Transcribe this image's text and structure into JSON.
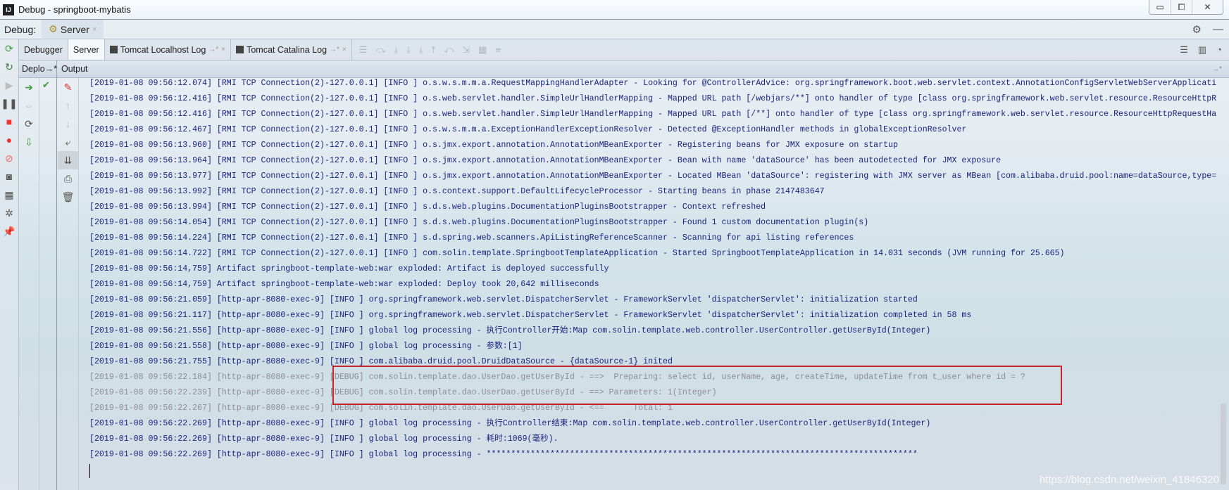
{
  "window": {
    "title": "Debug - springboot-mybatis",
    "app_icon": "IJ",
    "min": "▭",
    "max": "⧠",
    "close": "✕"
  },
  "debugbar": {
    "label": "Debug:",
    "tab": "Server",
    "close": "×",
    "settings": "⚙",
    "hide": "—"
  },
  "tabs": [
    {
      "label": "Debugger"
    },
    {
      "label": "Server"
    },
    {
      "label": "Tomcat Localhost Log",
      "pin": "→*",
      "close": "×"
    },
    {
      "label": "Tomcat Catalina Log",
      "pin": "→*",
      "close": "×"
    }
  ],
  "subheader": {
    "deploy": "Deplo→*",
    "output": "Output",
    "pin": "→*"
  },
  "log": [
    {
      "level": "info",
      "text": "[2019-01-08 09:56:12.074] [RMI TCP Connection(2)-127.0.0.1] [INFO ] o.s.w.s.m.m.a.RequestMappingHandlerAdapter - Looking for @ControllerAdvice: org.springframework.boot.web.servlet.context.AnnotationConfigServletWebServerApplicati"
    },
    {
      "level": "info",
      "text": "[2019-01-08 09:56:12.416] [RMI TCP Connection(2)-127.0.0.1] [INFO ] o.s.web.servlet.handler.SimpleUrlHandlerMapping - Mapped URL path [/webjars/**] onto handler of type [class org.springframework.web.servlet.resource.ResourceHttpR"
    },
    {
      "level": "info",
      "text": "[2019-01-08 09:56:12.416] [RMI TCP Connection(2)-127.0.0.1] [INFO ] o.s.web.servlet.handler.SimpleUrlHandlerMapping - Mapped URL path [/**] onto handler of type [class org.springframework.web.servlet.resource.ResourceHttpRequestHa"
    },
    {
      "level": "info",
      "text": "[2019-01-08 09:56:12.467] [RMI TCP Connection(2)-127.0.0.1] [INFO ] o.s.w.s.m.m.a.ExceptionHandlerExceptionResolver - Detected @ExceptionHandler methods in globalExceptionResolver"
    },
    {
      "level": "info",
      "text": "[2019-01-08 09:56:13.960] [RMI TCP Connection(2)-127.0.0.1] [INFO ] o.s.jmx.export.annotation.AnnotationMBeanExporter - Registering beans for JMX exposure on startup"
    },
    {
      "level": "info",
      "text": "[2019-01-08 09:56:13.964] [RMI TCP Connection(2)-127.0.0.1] [INFO ] o.s.jmx.export.annotation.AnnotationMBeanExporter - Bean with name 'dataSource' has been autodetected for JMX exposure"
    },
    {
      "level": "info",
      "text": "[2019-01-08 09:56:13.977] [RMI TCP Connection(2)-127.0.0.1] [INFO ] o.s.jmx.export.annotation.AnnotationMBeanExporter - Located MBean 'dataSource': registering with JMX server as MBean [com.alibaba.druid.pool:name=dataSource,type="
    },
    {
      "level": "info",
      "text": "[2019-01-08 09:56:13.992] [RMI TCP Connection(2)-127.0.0.1] [INFO ] o.s.context.support.DefaultLifecycleProcessor - Starting beans in phase 2147483647"
    },
    {
      "level": "info",
      "text": "[2019-01-08 09:56:13.994] [RMI TCP Connection(2)-127.0.0.1] [INFO ] s.d.s.web.plugins.DocumentationPluginsBootstrapper - Context refreshed"
    },
    {
      "level": "info",
      "text": "[2019-01-08 09:56:14.054] [RMI TCP Connection(2)-127.0.0.1] [INFO ] s.d.s.web.plugins.DocumentationPluginsBootstrapper - Found 1 custom documentation plugin(s)"
    },
    {
      "level": "info",
      "text": "[2019-01-08 09:56:14.224] [RMI TCP Connection(2)-127.0.0.1] [INFO ] s.d.spring.web.scanners.ApiListingReferenceScanner - Scanning for api listing references"
    },
    {
      "level": "info",
      "text": "[2019-01-08 09:56:14.722] [RMI TCP Connection(2)-127.0.0.1] [INFO ] com.solin.template.SpringbootTemplateApplication - Started SpringbootTemplateApplication in 14.031 seconds (JVM running for 25.665)"
    },
    {
      "level": "info",
      "text": "[2019-01-08 09:56:14,759] Artifact springboot-template-web:war exploded: Artifact is deployed successfully"
    },
    {
      "level": "info",
      "text": "[2019-01-08 09:56:14,759] Artifact springboot-template-web:war exploded: Deploy took 20,642 milliseconds"
    },
    {
      "level": "info",
      "text": "[2019-01-08 09:56:21.059] [http-apr-8080-exec-9] [INFO ] org.springframework.web.servlet.DispatcherServlet - FrameworkServlet 'dispatcherServlet': initialization started"
    },
    {
      "level": "info",
      "text": "[2019-01-08 09:56:21.117] [http-apr-8080-exec-9] [INFO ] org.springframework.web.servlet.DispatcherServlet - FrameworkServlet 'dispatcherServlet': initialization completed in 58 ms"
    },
    {
      "level": "info",
      "text": "[2019-01-08 09:56:21.556] [http-apr-8080-exec-9] [INFO ] global log processing - 执行Controller开始:Map com.solin.template.web.controller.UserController.getUserById(Integer)"
    },
    {
      "level": "info",
      "text": "[2019-01-08 09:56:21.558] [http-apr-8080-exec-9] [INFO ] global log processing - 参数:[1]"
    },
    {
      "level": "info",
      "text": "[2019-01-08 09:56:21.755] [http-apr-8080-exec-9] [INFO ] com.alibaba.druid.pool.DruidDataSource - {dataSource-1} inited"
    },
    {
      "level": "debug",
      "text": "[2019-01-08 09:56:22.184] [http-apr-8080-exec-9] [DEBUG] com.solin.template.dao.UserDao.getUserById - ==>  Preparing: select id, userName, age, createTime, updateTime from t_user where id = ?"
    },
    {
      "level": "debug",
      "text": "[2019-01-08 09:56:22.239] [http-apr-8080-exec-9] [DEBUG] com.solin.template.dao.UserDao.getUserById - ==> Parameters: 1(Integer)"
    },
    {
      "level": "debug",
      "text": "[2019-01-08 09:56:22.267] [http-apr-8080-exec-9] [DEBUG] com.solin.template.dao.UserDao.getUserById - <==      Total: 1"
    },
    {
      "level": "info",
      "text": "[2019-01-08 09:56:22.269] [http-apr-8080-exec-9] [INFO ] global log processing - 执行Controller结束:Map com.solin.template.web.controller.UserController.getUserById(Integer)"
    },
    {
      "level": "info",
      "text": "[2019-01-08 09:56:22.269] [http-apr-8080-exec-9] [INFO ] global log processing - 耗时:1069(毫秒)."
    },
    {
      "level": "info",
      "text": "[2019-01-08 09:56:22.269] [http-apr-8080-exec-9] [INFO ] global log processing - ****************************************************************************************"
    }
  ],
  "watermark": "https://blog.csdn.net/weixin_41846320"
}
